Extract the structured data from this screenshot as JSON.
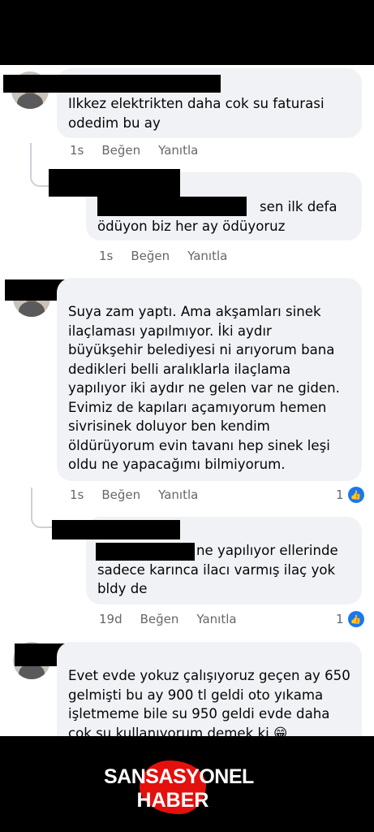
{
  "comments": [
    {
      "text_lines": [
        "Ilkkez elektrikten daha cok su faturasi",
        "odedim bu ay"
      ],
      "time": "1s",
      "like_label": "Beğen",
      "reply_label": "Yanıtla"
    },
    {
      "text_lines": [
        "sen ilk defa",
        "ödüyon biz her ay ödüyoruz"
      ],
      "time": "1s",
      "like_label": "Beğen",
      "reply_label": "Yanıtla"
    },
    {
      "text_lines": [
        "Suya zam yaptı. Ama akşamları sinek",
        "ilaçlaması yapılmıyor. İki aydır",
        "büyükşehir belediyesi ni arıyorum bana",
        "dedikleri belli aralıklarla ilaçlama",
        "yapılıyor iki aydır ne gelen var ne giden.",
        "Evimiz de kapıları açamıyorum hemen",
        "sivrisinek doluyor ben kendim",
        "öldürüyorum evin tavanı hep sinek leşi",
        "oldu ne yapacağımı bilmiyorum."
      ],
      "time": "1s",
      "like_label": "Beğen",
      "reply_label": "Yanıtla",
      "reaction_count": "1"
    },
    {
      "text_lines": [
        "ne yapılıyor ellerinde",
        "sadece karınca ilacı varmış ilaç yok",
        "bldy de"
      ],
      "time": "19d",
      "like_label": "Beğen",
      "reply_label": "Yanıtla",
      "reaction_count": "1"
    },
    {
      "text_lines": [
        "Evet evde yokuz çalışıyoruz geçen ay 650",
        "gelmişti bu ay 900 tl geldi oto yıkama",
        "işletmeme bile su 950 geldi evde daha",
        "çok su kullanıyorum demek ki 😁"
      ]
    }
  ],
  "watermark": {
    "line1": "SANSASYONEL",
    "line2": "HABER",
    "brand_red": "#e3100e"
  },
  "icons": {
    "like": "thumbs-up-icon"
  },
  "colors": {
    "bubble": "#f0f2f5",
    "meta": "#65676b",
    "like_blue": "#1877f2"
  }
}
